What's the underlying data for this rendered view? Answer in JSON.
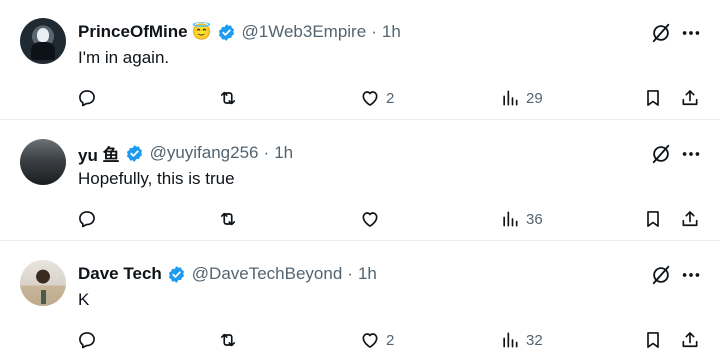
{
  "tweets": [
    {
      "name": "PrinceOfMine",
      "emoji": "😇",
      "handle": "@1Web3Empire",
      "time": "1h",
      "text": "I'm in again.",
      "replies": "",
      "retweets": "",
      "likes": "2",
      "views": "29"
    },
    {
      "name": "yu 鱼",
      "emoji": "",
      "handle": "@yuyifang256",
      "time": "1h",
      "text": "Hopefully, this is true",
      "replies": "",
      "retweets": "",
      "likes": "",
      "views": "36"
    },
    {
      "name": "Dave Tech",
      "emoji": "",
      "handle": "@DaveTechBeyond",
      "time": "1h",
      "text": "K",
      "replies": "",
      "retweets": "",
      "likes": "2",
      "views": "32"
    }
  ],
  "separator": "·",
  "colors": {
    "verified": "#1d9bf0",
    "text": "#0f1419",
    "muted": "#536471"
  },
  "icons": [
    "reply-icon",
    "retweet-icon",
    "like-icon",
    "views-icon",
    "bookmark-icon",
    "share-icon",
    "grok-icon",
    "more-icon",
    "verified-badge-icon"
  ]
}
